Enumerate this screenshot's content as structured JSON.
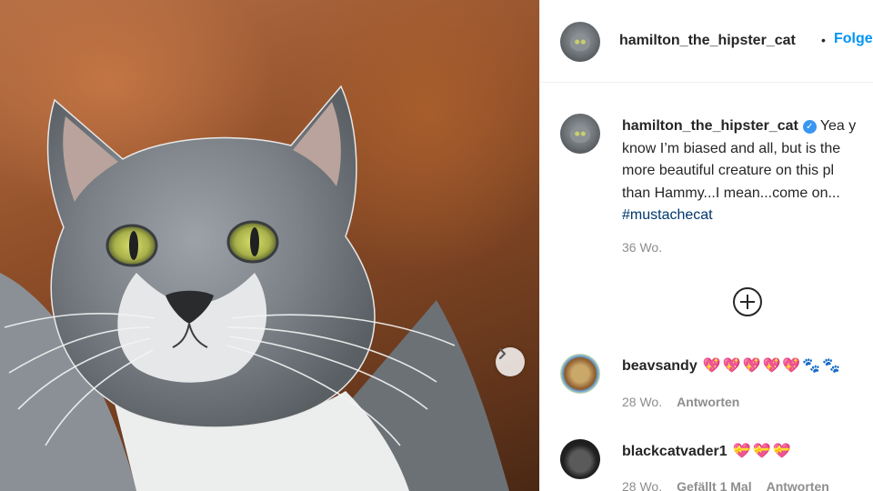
{
  "header": {
    "username": "hamilton_the_hipster_cat",
    "separator": "•",
    "follow_label": "Folge"
  },
  "caption": {
    "username": "hamilton_the_hipster_cat",
    "lines": [
      "Yea y",
      "know I’m biased and all, but is the",
      "more beautiful creature on this pl",
      "than Hammy...I mean...come on..."
    ],
    "hashtag": "#mustachecat",
    "time": "36 Wo."
  },
  "comments": [
    {
      "username": "beavsandy",
      "text": "💖💖💖💖💖🐾🐾",
      "time": "28 Wo.",
      "reply": "Antworten"
    },
    {
      "username": "blackcatvader1",
      "text": "💝💝💝",
      "time": "28 Wo.",
      "likes": "Gefällt 1 Mal",
      "reply": "Antworten"
    }
  ],
  "icons": {
    "next": "chevron-right-icon",
    "add": "plus-circle-icon",
    "verified": "verified-badge-icon"
  },
  "colors": {
    "accent": "#0095f6",
    "hashtag": "#00376b",
    "muted": "#8e8e8e",
    "verified": "#3897f0"
  }
}
